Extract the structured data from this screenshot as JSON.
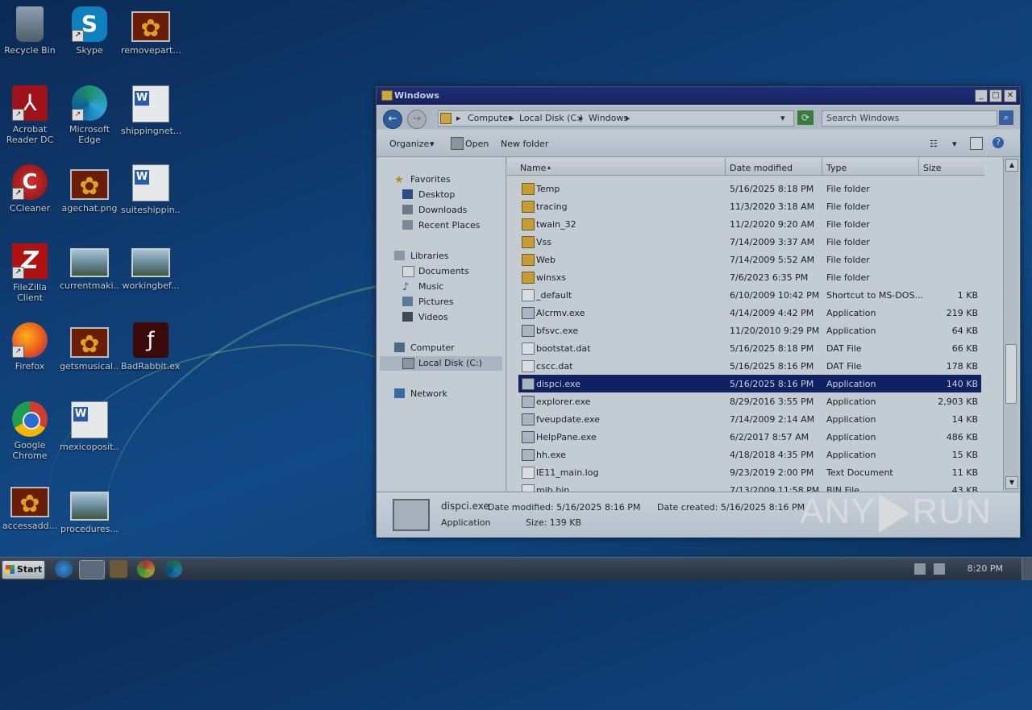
{
  "desktop": {
    "icons": [
      {
        "label": "Recycle Bin"
      },
      {
        "label": "Skype"
      },
      {
        "label": "removepart..."
      },
      {
        "label": "Acrobat Reader DC"
      },
      {
        "label": "Microsoft Edge"
      },
      {
        "label": "shippingnet..."
      },
      {
        "label": "CCleaner"
      },
      {
        "label": "agechat.png"
      },
      {
        "label": "suiteshippin..."
      },
      {
        "label": "FileZilla Client"
      },
      {
        "label": "currentmaki..."
      },
      {
        "label": "workingbef..."
      },
      {
        "label": "Firefox"
      },
      {
        "label": "getsmusical..."
      },
      {
        "label": "BadRabbit.exe"
      },
      {
        "label": "Google Chrome"
      },
      {
        "label": "mexicoposit..."
      },
      {
        "label": "accessadd..."
      },
      {
        "label": "procedures..."
      }
    ]
  },
  "window": {
    "title": "Windows",
    "address": [
      "Computer",
      "Local Disk (C:)",
      "Windows"
    ],
    "search_placeholder": "Search Windows",
    "toolbar": {
      "organize": "Organize",
      "open": "Open",
      "new_folder": "New folder"
    },
    "nav": {
      "favorites": "Favorites",
      "desktop": "Desktop",
      "downloads": "Downloads",
      "recent": "Recent Places",
      "libraries": "Libraries",
      "documents": "Documents",
      "music": "Music",
      "pictures": "Pictures",
      "videos": "Videos",
      "computer": "Computer",
      "local_disk": "Local Disk (C:)",
      "network": "Network"
    },
    "columns": {
      "name": "Name",
      "date": "Date modified",
      "type": "Type",
      "size": "Size"
    },
    "files": [
      {
        "name": "Temp",
        "date": "5/16/2025 8:18 PM",
        "type": "File folder",
        "size": "",
        "kind": "folder"
      },
      {
        "name": "tracing",
        "date": "11/3/2020 3:18 AM",
        "type": "File folder",
        "size": "",
        "kind": "folder"
      },
      {
        "name": "twain_32",
        "date": "11/2/2020 9:20 AM",
        "type": "File folder",
        "size": "",
        "kind": "folder"
      },
      {
        "name": "Vss",
        "date": "7/14/2009 3:37 AM",
        "type": "File folder",
        "size": "",
        "kind": "folder"
      },
      {
        "name": "Web",
        "date": "7/14/2009 5:52 AM",
        "type": "File folder",
        "size": "",
        "kind": "folder"
      },
      {
        "name": "winsxs",
        "date": "7/6/2023 6:35 PM",
        "type": "File folder",
        "size": "",
        "kind": "folder"
      },
      {
        "name": "_default",
        "date": "6/10/2009 10:42 PM",
        "type": "Shortcut to MS-DOS...",
        "size": "1 KB",
        "kind": "file"
      },
      {
        "name": "Alcrmv.exe",
        "date": "4/14/2009 4:42 PM",
        "type": "Application",
        "size": "219 KB",
        "kind": "app"
      },
      {
        "name": "bfsvc.exe",
        "date": "11/20/2010 9:29 PM",
        "type": "Application",
        "size": "64 KB",
        "kind": "app"
      },
      {
        "name": "bootstat.dat",
        "date": "5/16/2025 8:18 PM",
        "type": "DAT File",
        "size": "66 KB",
        "kind": "file"
      },
      {
        "name": "cscc.dat",
        "date": "5/16/2025 8:16 PM",
        "type": "DAT File",
        "size": "178 KB",
        "kind": "file"
      },
      {
        "name": "dispci.exe",
        "date": "5/16/2025 8:16 PM",
        "type": "Application",
        "size": "140 KB",
        "kind": "app",
        "selected": true
      },
      {
        "name": "explorer.exe",
        "date": "8/29/2016 3:55 PM",
        "type": "Application",
        "size": "2,903 KB",
        "kind": "app"
      },
      {
        "name": "fveupdate.exe",
        "date": "7/14/2009 2:14 AM",
        "type": "Application",
        "size": "14 KB",
        "kind": "app"
      },
      {
        "name": "HelpPane.exe",
        "date": "6/2/2017 8:57 AM",
        "type": "Application",
        "size": "486 KB",
        "kind": "app"
      },
      {
        "name": "hh.exe",
        "date": "4/18/2018 4:35 PM",
        "type": "Application",
        "size": "15 KB",
        "kind": "app"
      },
      {
        "name": "IE11_main.log",
        "date": "9/23/2019 2:00 PM",
        "type": "Text Document",
        "size": "11 KB",
        "kind": "file"
      },
      {
        "name": "mib.bin",
        "date": "7/13/2009 11:58 PM",
        "type": "BIN File",
        "size": "43 KB",
        "kind": "file"
      }
    ],
    "details": {
      "name": "dispci.exe",
      "modified": "Date modified: 5/16/2025 8:16 PM",
      "created": "Date created: 5/16/2025 8:16 PM",
      "type": "Application",
      "size": "Size: 139 KB"
    }
  },
  "watermark": {
    "left": "ANY",
    "right": "RUN"
  },
  "taskbar": {
    "start": "Start",
    "clock": "8:20 PM"
  }
}
